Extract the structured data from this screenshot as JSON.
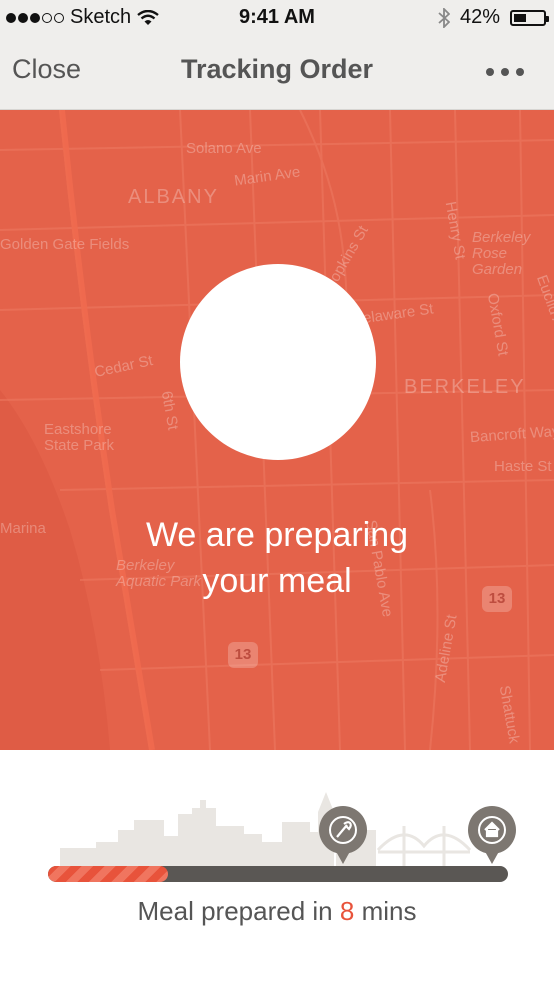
{
  "status_bar": {
    "carrier": "Sketch",
    "time": "9:41 AM",
    "battery_text": "42%",
    "battery_level": 0.42,
    "signal_bars_filled": 3,
    "signal_bars_total": 5,
    "icons": [
      "wifi-icon",
      "bluetooth-icon",
      "battery-icon"
    ]
  },
  "nav": {
    "close_label": "Close",
    "title": "Tracking Order",
    "more_icon": "more-dots-icon"
  },
  "map": {
    "background_color": "#e4624a",
    "street_labels": [
      "Solano Ave",
      "Marin Ave",
      "ALBANY",
      "Golden Gate Fields",
      "Cedar St",
      "6th St",
      "Eastshore State Park",
      "Marina",
      "Berkeley Aquatic Park",
      "BERKELEY",
      "Henry St",
      "Oxford St",
      "Berkeley Rose Garden",
      "Euclid Ave",
      "Bancroft Way",
      "Haste St",
      "Adeline St",
      "Shattuck",
      "San Pablo Ave",
      "Hopkins St",
      "Delaware St"
    ],
    "highway_shields": [
      "13",
      "13"
    ]
  },
  "order": {
    "headline_line1": "We are preparing",
    "headline_line2": "your meal"
  },
  "progress": {
    "fraction": 0.26,
    "start_pin_icon": "restaurant-pin-icon",
    "end_pin_icon": "home-pin-icon",
    "status_prefix": "Meal prepared in",
    "minutes": "8",
    "status_suffix": "mins",
    "accent_color": "#e8533b",
    "track_color": "#5a5754"
  }
}
